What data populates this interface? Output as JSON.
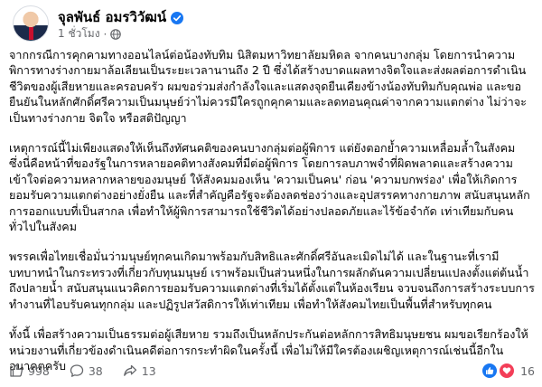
{
  "post": {
    "author": "จุลพันธ์ อมรวิวัฒน์",
    "timestamp": "1 ชั่วโมง",
    "meta_separator": "·",
    "paragraphs": [
      "จากกรณีการคุกคามทางออนไลน์ต่อน้องทับทิม นิสิตมหาวิทยาลัยมหิดล จากคนบางกลุ่ม โดยการนำความ\nพิการทางร่างกายมาล้อเลียนเป็นระยะเวลานานถึง 2 ปี ซึ่งได้สร้างบาดแผลทางจิตใจและส่งผลต่อการดำเนิน\nชีวิตของผู้เสียหายและครอบครัว ผมขอร่วมส่งกำลังใจและแสดงจุดยืนเคียงข้างน้องทับทิมกับคุณพ่อ และขอ\nยืนยันในหลักศักดิ์ศรีความเป็นมนุษย์ว่าไม่ควรมีใครถูกคุกคามและลดทอนคุณค่าจากความแตกต่าง ไม่ว่าจะ\nเป็นทางร่างกาย จิตใจ หรือสติปัญญา",
      "เหตุการณ์นี้ไม่เพียงแสดงให้เห็นถึงทัศนคติของคนบางกลุ่มต่อผู้พิการ แต่ยังตอกย้ำความเหลื่อมล้ำในสังคม\nซึ่งนี่คือหน้าที่ของรัฐในการหลายอคติทางสังคมที่มีต่อผู้พิการ โดยการลบภาพจำที่ผิดพลาดและสร้างความ\nเข้าใจต่อความหลากหลายของมนุษย์ ให้สังคมมองเห็น 'ความเป็นคน' ก่อน 'ความบกพร่อง' เพื่อให้เกิดการ\nยอมรับความแตกต่างอย่างยั่งยืน และที่สำคัญคือรัฐจะต้องลดช่องว่างและอุปสรรคทางกายภาพ สนับสนุนหลัก\nการออกแบบที่เป็นสากล เพื่อทำให้ผู้พิการสามารถใช้ชีวิตได้อย่างปลอดภัยและไร้ข้อจำกัด เท่าเทียมกับคน\nทั่วไปในสังคม",
      "พรรคเพื่อไทยเชื่อมั่นว่ามนุษย์ทุกคนเกิดมาพร้อมกับสิทธิและศักดิ์ศรีอันละเมิดไม่ได้ และในฐานะที่เรามี\nบทบาทนำในกระทรวงที่เกี่ยวกับทุนมนุษย์ เราพร้อมเป็นส่วนหนึ่งในการผลักดันความเปลี่ยนแปลงตั้งแต่ต้นน้ำ\nถึงปลายน้ำ สนับสนุนแนวคิดการยอมรับความแตกต่างที่เริ่มได้ตั้งแต่ในห้องเรียน จวบจนถึงการสร้างระบบการ\nทำงานที่ไอบรับคนทุกกลุ่ม และปฏิรูปสวัสดิการให้เท่าเทียม เพื่อทำให้สังคมไทยเป็นพื้นที่สำหรับทุกคน",
      "ทั้งนี้ เพื่อสร้างความเป็นธรรมต่อผู้เสียหาย รวมถึงเป็นหลักประกันต่อหลักการสิทธิมนุษยชน ผมขอเรียกร้องให้\nหน่วยงานที่เกี่ยวข้องดำเนินคดีต่อการกระทำผิดในครั้งนี้ เพื่อไม่ให้มีใครต้องเผชิญเหตุการณ์เช่นนี้อีกใน\nอนาคตครับ"
    ]
  },
  "reactions": {
    "likes": "998",
    "comments": "38",
    "shares": "13",
    "reaction_total": "16"
  },
  "icons": {
    "verified": "verified-badge-icon",
    "privacy": "globe-icon",
    "like": "thumbs-up-icon",
    "comment": "comment-icon",
    "share": "share-icon",
    "like_reaction": "like-reaction-icon",
    "love_reaction": "love-reaction-icon",
    "more": "more-options-icon"
  },
  "colors": {
    "verified_blue": "#1877f2",
    "meta_gray": "#65676b",
    "love_red": "#f33e58",
    "text": "#050505"
  }
}
